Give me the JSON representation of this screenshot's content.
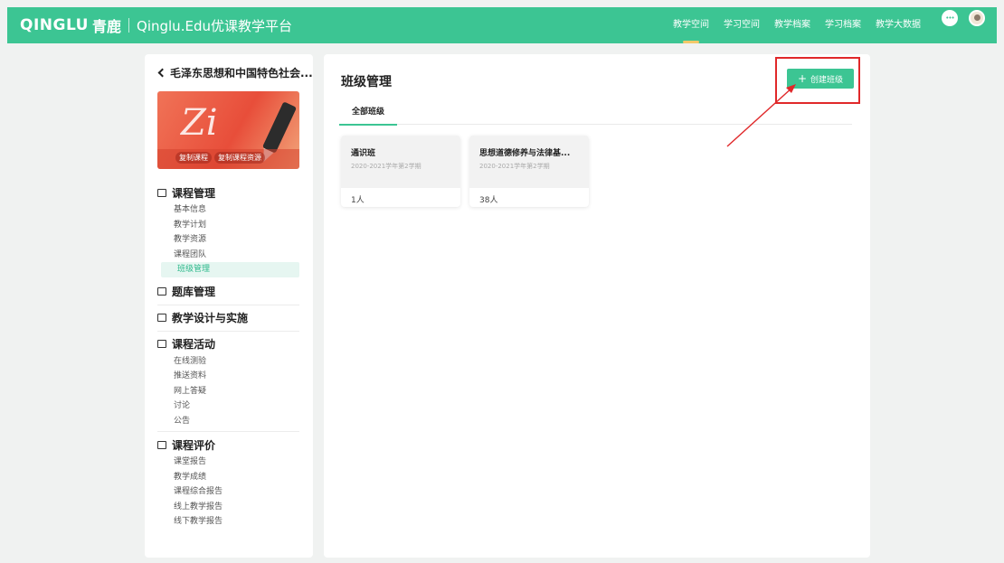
{
  "header": {
    "brand": "QINGLU",
    "brand_cn": "青鹿",
    "platform": "Qinglu.Edu优课教学平台",
    "nav": [
      "教学空间",
      "学习空间",
      "教学档案",
      "学习档案",
      "教学大数据"
    ],
    "active_nav": "教学空间",
    "icons": [
      "message-icon",
      "user-avatar"
    ]
  },
  "sidebar": {
    "course_title": "毛泽东思想和中国特色社会...",
    "cover_buttons": [
      "复制课程",
      "复制课程资源"
    ],
    "sections": [
      {
        "title": "课程管理",
        "icon": "course-icon",
        "items": [
          "基本信息",
          "教学计划",
          "教学资源",
          "课程团队",
          "班级管理"
        ]
      },
      {
        "title": "题库管理",
        "icon": "question-bank-icon",
        "items": []
      },
      {
        "title": "教学设计与实施",
        "icon": "design-icon",
        "items": []
      },
      {
        "title": "课程活动",
        "icon": "activity-icon",
        "items": [
          "在线测验",
          "推送资料",
          "网上答疑",
          "讨论",
          "公告"
        ]
      },
      {
        "title": "课程评价",
        "icon": "evaluation-icon",
        "items": [
          "课堂报告",
          "教学成绩",
          "课程综合报告",
          "线上教学报告",
          "线下教学报告"
        ]
      }
    ],
    "active_item": "班级管理"
  },
  "main": {
    "title": "班级管理",
    "tab": "全部班级",
    "create_button": "创建班级",
    "classes": [
      {
        "name": "通识班",
        "term": "2020-2021学年第2学期",
        "count": "1人"
      },
      {
        "name": "思想道德修养与法律基...",
        "term": "2020-2021学年第2学期",
        "count": "38人"
      }
    ]
  },
  "colors": {
    "brand_green": "#3cc593",
    "annotation_red": "#e0282a",
    "nav_indicator": "#f3c969"
  }
}
